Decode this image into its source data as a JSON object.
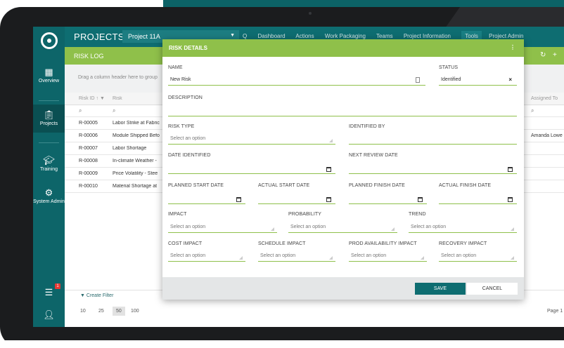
{
  "header": {
    "app_title": "PROJECTS",
    "project": "Project 11A",
    "nav": [
      "Q",
      "Dashboard",
      "Actions",
      "Work Packaging",
      "Teams",
      "Project Information",
      "Tools",
      "Project Admin"
    ]
  },
  "sidebar": {
    "items": [
      {
        "label": "Overview",
        "icon": "overview-icon"
      },
      {
        "label": "Projects",
        "icon": "clipboard-icon"
      },
      {
        "label": "Training",
        "icon": "graduation-cap-icon"
      },
      {
        "label": "System Admin",
        "icon": "gear-icon"
      }
    ],
    "notifications": "1"
  },
  "subheader": {
    "title": "RISK LOG"
  },
  "grid": {
    "drag_hint": "Drag a column header here to group",
    "columns": [
      "Risk ID",
      "Risk",
      "Assigned To"
    ],
    "rows": [
      {
        "id": "R-00005",
        "risk": "Labor Strike at Fabric",
        "assigned": ""
      },
      {
        "id": "R-00006",
        "risk": "Module Shipped Befo",
        "assigned": "Amanda Lowe"
      },
      {
        "id": "R-00007",
        "risk": "Labor Shortage",
        "assigned": ""
      },
      {
        "id": "R-00008",
        "risk": "In-climate Weather -",
        "assigned": ""
      },
      {
        "id": "R-00009",
        "risk": "Price Volatility - Stee",
        "assigned": ""
      },
      {
        "id": "R-00010",
        "risk": "Material Shortage at",
        "assigned": ""
      }
    ],
    "create_filter": "Create Filter",
    "page_sizes": [
      "10",
      "25",
      "50",
      "100"
    ],
    "page_label": "Page 1"
  },
  "modal": {
    "title": "RISK DETAILS",
    "name_label": "NAME",
    "name_value": "New Risk",
    "status_label": "STATUS",
    "status_value": "Identified",
    "description_label": "DESCRIPTION",
    "risk_type_label": "RISK TYPE",
    "identified_by_label": "IDENTIFIED BY",
    "date_identified_label": "DATE IDENTIFIED",
    "next_review_label": "NEXT REVIEW DATE",
    "planned_start_label": "PLANNED START DATE",
    "actual_start_label": "ACTUAL START DATE",
    "planned_finish_label": "PLANNED FINISH DATE",
    "actual_finish_label": "ACTUAL FINISH DATE",
    "impact_label": "IMPACT",
    "probability_label": "PROBABILITY",
    "trend_label": "TREND",
    "cost_impact_label": "COST IMPACT",
    "schedule_impact_label": "SCHEDULE IMPACT",
    "prod_availability_label": "PROD AVAILABILITY IMPACT",
    "recovery_impact_label": "RECOVERY IMPACT",
    "select_placeholder": "Select an option",
    "save_label": "SAVE",
    "cancel_label": "CANCEL"
  },
  "colors": {
    "teal": "#0e6d71",
    "green": "#8fc04a"
  }
}
